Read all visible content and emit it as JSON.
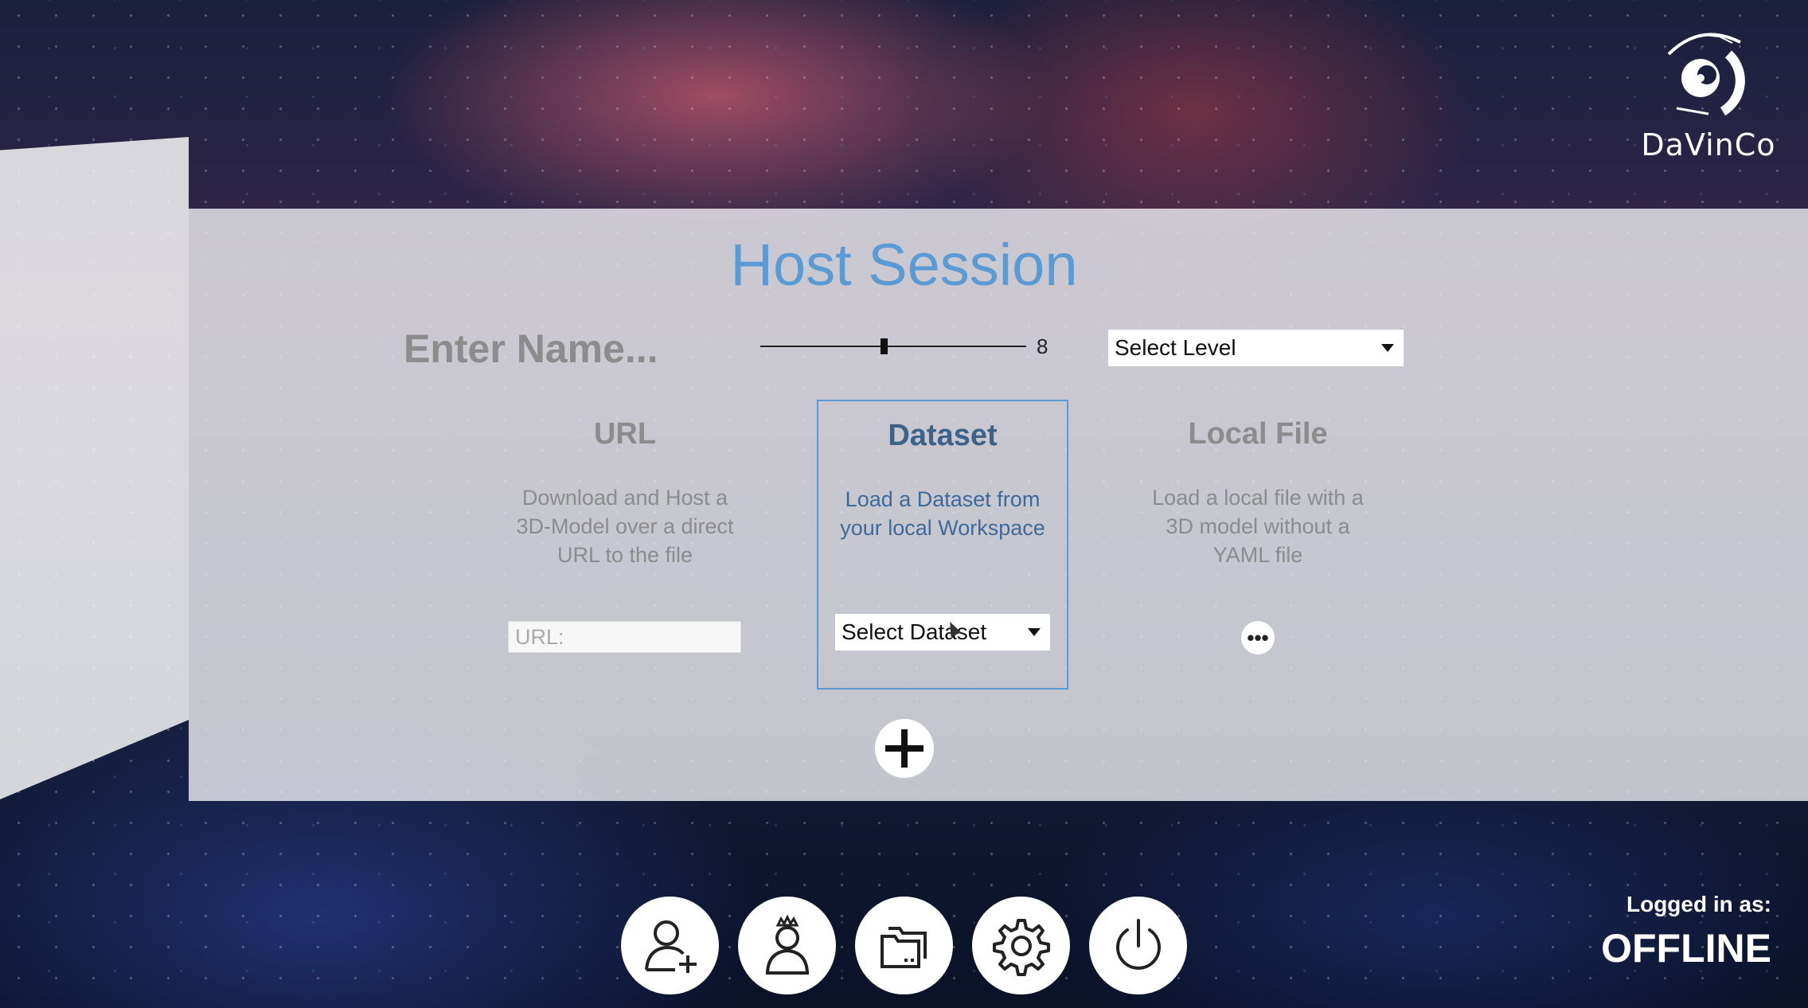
{
  "brand": {
    "name": "DaVinCo"
  },
  "page": {
    "title": "Host Session"
  },
  "session": {
    "name_placeholder": "Enter Name...",
    "slider_value": "8",
    "slider_fraction": 0.47,
    "level_select": "Select Level"
  },
  "options": {
    "url": {
      "title": "URL",
      "description": "Download and Host a 3D-Model over a direct URL to the file",
      "input_placeholder": "URL:"
    },
    "dataset": {
      "title": "Dataset",
      "description": "Load a Dataset from your local Workspace",
      "select_value": "Select Dataset"
    },
    "local_file": {
      "title": "Local File",
      "description": "Load a local file with a 3D model without a YAML file",
      "button_label": "•••"
    }
  },
  "bottom_bar": {
    "buttons": [
      "add-user-icon",
      "host-user-icon",
      "folders-icon",
      "gear-icon",
      "power-icon"
    ]
  },
  "login": {
    "label": "Logged in as:",
    "status": "OFFLINE"
  },
  "colors": {
    "accent": "#5b9bd5",
    "panel": "#f0f0f2"
  }
}
